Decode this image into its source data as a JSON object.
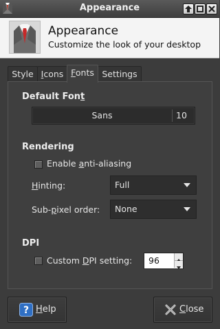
{
  "window": {
    "title": "Appearance",
    "controls": [
      "up-arrow-icon",
      "maximize-icon",
      "close-icon"
    ]
  },
  "header": {
    "title": "Appearance",
    "subtitle": "Customize the look of your desktop",
    "icon": "suit-icon"
  },
  "tabs": [
    {
      "label": "Style",
      "mnemonic": ""
    },
    {
      "label": "Icons",
      "mnemonic": "I"
    },
    {
      "label": "Fonts",
      "mnemonic": "F",
      "active": true
    },
    {
      "label": "Settings",
      "mnemonic": ""
    }
  ],
  "fonts_page": {
    "default_font": {
      "heading_pre": "Default Fon",
      "heading_mn": "t",
      "name": "Sans",
      "size": "10"
    },
    "rendering": {
      "heading": "Rendering",
      "antialias_pre": "Enable ",
      "antialias_mn": "a",
      "antialias_post": "nti-aliasing",
      "antialias_checked": false,
      "hinting_pre": "",
      "hinting_mn": "H",
      "hinting_post": "inting:",
      "hinting_value": "Full",
      "subpixel_pre": "Sub-",
      "subpixel_mn": "p",
      "subpixel_post": "ixel order:",
      "subpixel_value": "None"
    },
    "dpi": {
      "heading": "DPI",
      "custom_pre": "Custom ",
      "custom_mn": "D",
      "custom_post": "PI setting:",
      "custom_checked": false,
      "value": "96"
    }
  },
  "buttons": {
    "help_mn": "H",
    "help_rest": "elp",
    "close_mn": "C",
    "close_rest": "lose"
  },
  "colors": {
    "background": "#3c3c3c",
    "header_bg": "#f4f4f4",
    "help_icon_blue": "#2f6fc4"
  }
}
